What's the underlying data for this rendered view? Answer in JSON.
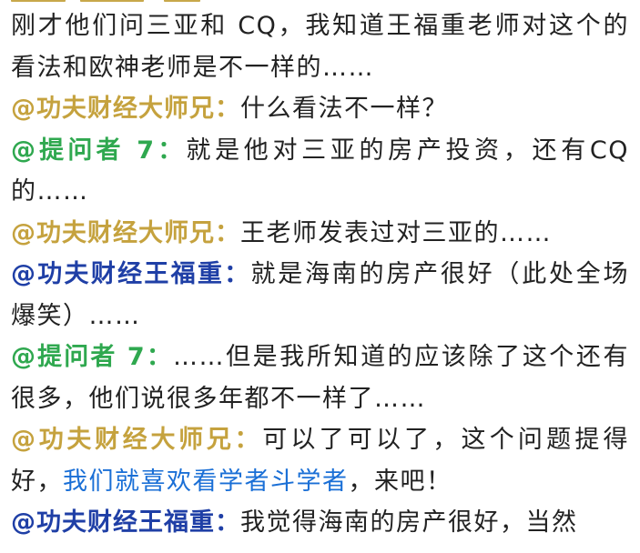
{
  "colors": {
    "text": "#222222",
    "dashi": "#c5a23e",
    "tiwen": "#2fa84f",
    "wang": "#1f3fa6",
    "link": "#1a6fd6"
  },
  "paragraphs": [
    {
      "speaker": "",
      "text": "刚才他们问三亚和 CQ，我知道王福重老师对这个的看法和欧神老师是不一样的……"
    },
    {
      "speaker": "@功夫财经大师兄：",
      "text": "什么看法不一样？"
    },
    {
      "speaker": "@提问者 7：",
      "text": "就是他对三亚的房产投资，还有CQ的……"
    },
    {
      "speaker": "@功夫财经大师兄：",
      "text": "王老师发表过对三亚的……"
    },
    {
      "speaker": "@功夫财经王福重：",
      "text": "就是海南的房产很好（此处全场爆笑）……"
    },
    {
      "speaker": "@提问者 7：",
      "text": "……但是我所知道的应该除了这个还有很多，他们说很多年都不一样了……"
    },
    {
      "speaker": "@功夫财经大师兄：",
      "text_before": "可以了可以了，这个问题提得好，",
      "link": "我们就喜欢看学者斗学者",
      "text_after": "，来吧！"
    },
    {
      "speaker": "@功夫财经王福重：",
      "text": "我觉得海南的房产很好，当然"
    }
  ]
}
